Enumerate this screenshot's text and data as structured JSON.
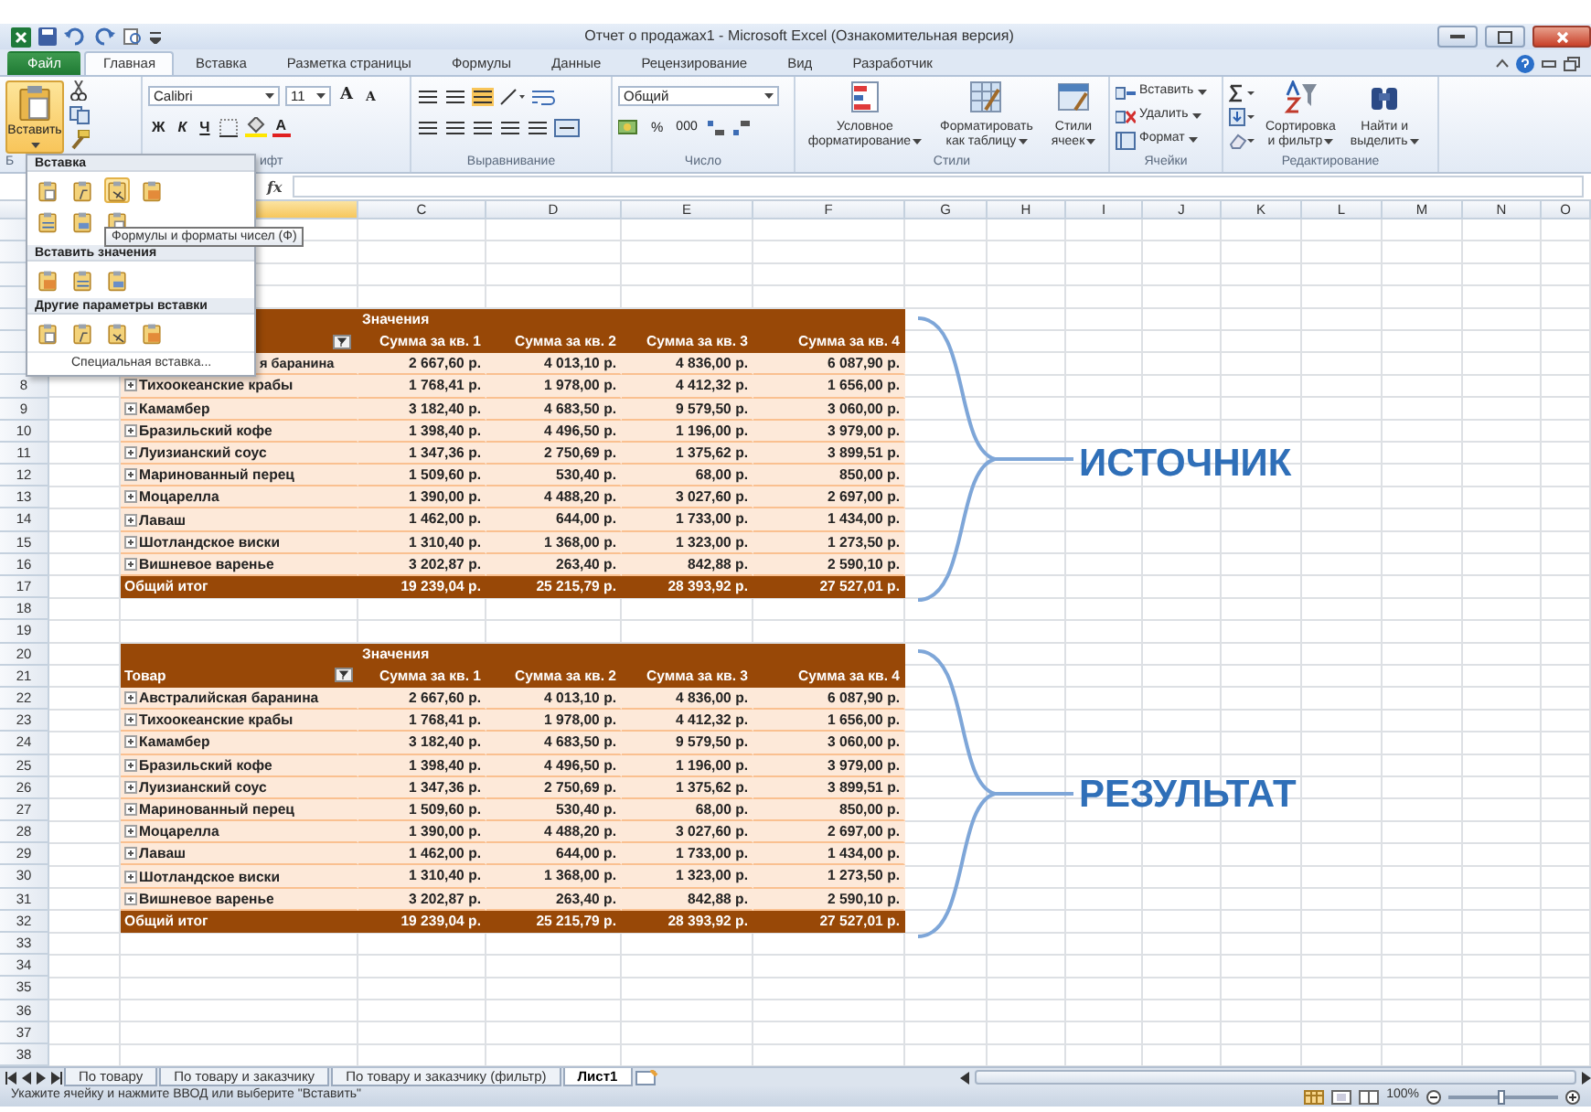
{
  "window": {
    "title": "Отчет о продажах1 - Microsoft Excel (Ознакомительная версия)"
  },
  "ribbon_tabs": [
    {
      "label": "Файл",
      "kind": "file",
      "selected": false
    },
    {
      "label": "Главная",
      "kind": "tab",
      "selected": true
    },
    {
      "label": "Вставка",
      "kind": "tab",
      "selected": false
    },
    {
      "label": "Разметка страницы",
      "kind": "tab",
      "selected": false
    },
    {
      "label": "Формулы",
      "kind": "tab",
      "selected": false
    },
    {
      "label": "Данные",
      "kind": "tab",
      "selected": false
    },
    {
      "label": "Рецензирование",
      "kind": "tab",
      "selected": false
    },
    {
      "label": "Вид",
      "kind": "tab",
      "selected": false
    },
    {
      "label": "Разработчик",
      "kind": "tab",
      "selected": false
    }
  ],
  "ribbon": {
    "paste_button": {
      "label": "Вставить",
      "open": true
    },
    "font_name": "Calibri",
    "font_size": "11",
    "grow_label": "A",
    "shrink_label": "A",
    "bold": "Ж",
    "italic": "К",
    "underline": "Ч",
    "font_color_label": "A",
    "number_format": "Общий",
    "percent": "%",
    "thousands": "000",
    "styles_buttons": [
      {
        "lines": [
          "Условное",
          "форматирование"
        ]
      },
      {
        "lines": [
          "Форматировать",
          "как таблицу"
        ]
      },
      {
        "lines": [
          "Стили",
          "ячеек"
        ]
      }
    ],
    "cells_buttons": [
      "Вставить",
      "Удалить",
      "Формат"
    ],
    "editing_buttons": [
      {
        "lines": [
          "Сортировка",
          "и фильтр"
        ]
      },
      {
        "lines": [
          "Найти и",
          "выделить"
        ]
      }
    ],
    "group_labels": [
      "Б",
      "ифт",
      "Выравнивание",
      "Число",
      "Стили",
      "Ячейки",
      "Редактирование"
    ]
  },
  "formula_bar": {
    "function_label": "fx"
  },
  "columns": [
    {
      "selected": true
    },
    {
      "letter": "C",
      "selected": false
    },
    {
      "letter": "D",
      "selected": false
    },
    {
      "letter": "E",
      "selected": false
    },
    {
      "letter": "F",
      "selected": false
    },
    {
      "letter": "G",
      "selected": false
    },
    {
      "letter": "H",
      "selected": false
    },
    {
      "letter": "I",
      "selected": false
    },
    {
      "letter": "J",
      "selected": false
    },
    {
      "letter": "K",
      "selected": false
    },
    {
      "letter": "L",
      "selected": false
    },
    {
      "letter": "M",
      "selected": false
    },
    {
      "letter": "N",
      "selected": false
    },
    {
      "letter": "O",
      "selected": false
    }
  ],
  "rows": [
    {
      "kind": "blank"
    },
    {
      "kind": "blank"
    },
    {
      "kind": "blank"
    },
    {
      "kind": "blank"
    },
    {
      "kind": "title",
      "title": "Значения"
    },
    {
      "kind": "header",
      "columns": [
        "Сумма за кв. 1",
        "Сумма за кв. 2",
        "Сумма за кв. 3",
        "Сумма за кв. 4"
      ]
    },
    {
      "kind": "item",
      "label": "я баранина",
      "clipped": true,
      "values": [
        "2 667,60 р.",
        "4 013,10 р.",
        "4 836,00 р.",
        "6 087,90 р."
      ]
    },
    {
      "number": "8",
      "kind": "item",
      "label": "Тихоокеанские крабы",
      "clipped": false,
      "values": [
        "1 768,41 р.",
        "1 978,00 р.",
        "4 412,32 р.",
        "1 656,00 р."
      ]
    },
    {
      "number": "9",
      "kind": "item",
      "label": "Камамбер",
      "clipped": false,
      "values": [
        "3 182,40 р.",
        "4 683,50 р.",
        "9 579,50 р.",
        "3 060,00 р."
      ]
    },
    {
      "number": "10",
      "kind": "item",
      "label": "Бразильский кофе",
      "clipped": false,
      "values": [
        "1 398,40 р.",
        "4 496,50 р.",
        "1 196,00 р.",
        "3 979,00 р."
      ]
    },
    {
      "number": "11",
      "kind": "item",
      "label": "Луизианский соус",
      "clipped": false,
      "values": [
        "1 347,36 р.",
        "2 750,69 р.",
        "1 375,62 р.",
        "3 899,51 р."
      ]
    },
    {
      "number": "12",
      "kind": "item",
      "label": "Маринованный перец",
      "clipped": false,
      "values": [
        "1 509,60 р.",
        "530,40 р.",
        "68,00 р.",
        "850,00 р."
      ]
    },
    {
      "number": "13",
      "kind": "item",
      "label": "Моцарелла",
      "clipped": false,
      "values": [
        "1 390,00 р.",
        "4 488,20 р.",
        "3 027,60 р.",
        "2 697,00 р."
      ]
    },
    {
      "number": "14",
      "kind": "item",
      "label": "Лаваш",
      "clipped": false,
      "values": [
        "1 462,00 р.",
        "644,00 р.",
        "1 733,00 р.",
        "1 434,00 р."
      ]
    },
    {
      "number": "15",
      "kind": "item",
      "label": "Шотландское виски",
      "clipped": false,
      "values": [
        "1 310,40 р.",
        "1 368,00 р.",
        "1 323,00 р.",
        "1 273,50 р."
      ]
    },
    {
      "number": "16",
      "kind": "item",
      "label": "Вишневое варенье",
      "clipped": false,
      "values": [
        "3 202,87 р.",
        "263,40 р.",
        "842,88 р.",
        "2 590,10 р."
      ]
    },
    {
      "number": "17",
      "kind": "total",
      "label": "Общий итог",
      "values": [
        "19 239,04 р.",
        "25 215,79 р.",
        "28 393,92 р.",
        "27 527,01 р."
      ]
    },
    {
      "number": "18",
      "kind": "blank"
    },
    {
      "number": "19",
      "kind": "blank"
    },
    {
      "number": "20",
      "kind": "title",
      "title": "Значения"
    },
    {
      "number": "21",
      "kind": "header",
      "label": "Товар",
      "columns": [
        "Сумма за кв. 1",
        "Сумма за кв. 2",
        "Сумма за кв. 3",
        "Сумма за кв. 4"
      ]
    },
    {
      "number": "22",
      "kind": "item",
      "label": "Австралийская баранина",
      "clipped": false,
      "values": [
        "2 667,60 р.",
        "4 013,10 р.",
        "4 836,00 р.",
        "6 087,90 р."
      ]
    },
    {
      "number": "23",
      "kind": "item",
      "label": "Тихоокеанские крабы",
      "clipped": false,
      "values": [
        "1 768,41 р.",
        "1 978,00 р.",
        "4 412,32 р.",
        "1 656,00 р."
      ]
    },
    {
      "number": "24",
      "kind": "item",
      "label": "Камамбер",
      "clipped": false,
      "values": [
        "3 182,40 р.",
        "4 683,50 р.",
        "9 579,50 р.",
        "3 060,00 р."
      ]
    },
    {
      "number": "25",
      "kind": "item",
      "label": "Бразильский кофе",
      "clipped": false,
      "values": [
        "1 398,40 р.",
        "4 496,50 р.",
        "1 196,00 р.",
        "3 979,00 р."
      ]
    },
    {
      "number": "26",
      "kind": "item",
      "label": "Луизианский соус",
      "clipped": false,
      "values": [
        "1 347,36 р.",
        "2 750,69 р.",
        "1 375,62 р.",
        "3 899,51 р."
      ]
    },
    {
      "number": "27",
      "kind": "item",
      "label": "Маринованный перец",
      "clipped": false,
      "values": [
        "1 509,60 р.",
        "530,40 р.",
        "68,00 р.",
        "850,00 р."
      ]
    },
    {
      "number": "28",
      "kind": "item",
      "label": "Моцарелла",
      "clipped": false,
      "values": [
        "1 390,00 р.",
        "4 488,20 р.",
        "3 027,60 р.",
        "2 697,00 р."
      ]
    },
    {
      "number": "29",
      "kind": "item",
      "label": "Лаваш",
      "clipped": false,
      "values": [
        "1 462,00 р.",
        "644,00 р.",
        "1 733,00 р.",
        "1 434,00 р."
      ]
    },
    {
      "number": "30",
      "kind": "item",
      "label": "Шотландское виски",
      "clipped": false,
      "values": [
        "1 310,40 р.",
        "1 368,00 р.",
        "1 323,00 р.",
        "1 273,50 р."
      ]
    },
    {
      "number": "31",
      "kind": "item",
      "label": "Вишневое варенье",
      "clipped": false,
      "values": [
        "3 202,87 р.",
        "263,40 р.",
        "842,88 р.",
        "2 590,10 р."
      ]
    },
    {
      "number": "32",
      "kind": "total",
      "label": "Общий итог",
      "values": [
        "19 239,04 р.",
        "25 215,79 р.",
        "28 393,92 р.",
        "27 527,01 р."
      ]
    },
    {
      "number": "33",
      "kind": "blank"
    },
    {
      "number": "34",
      "kind": "blank"
    },
    {
      "number": "35",
      "kind": "blank"
    },
    {
      "number": "36",
      "kind": "blank"
    },
    {
      "number": "37",
      "kind": "blank"
    },
    {
      "number": "38",
      "kind": "blank"
    }
  ],
  "annotations": [
    {
      "text": "ИСТОЧНИК"
    },
    {
      "text": "РЕЗУЛЬТАТ"
    }
  ],
  "paste_menu": {
    "sections": [
      {
        "title": "Вставка",
        "options": [
          {
            "highlighted": false
          },
          {
            "highlighted": false
          },
          {
            "highlighted": true
          },
          {
            "highlighted": false
          },
          {
            "highlighted": false
          },
          {
            "highlighted": false
          },
          {
            "highlighted": false
          }
        ]
      },
      {
        "title": "Вставить значения",
        "options": [
          {
            "highlighted": false
          },
          {
            "highlighted": false
          },
          {
            "highlighted": false
          }
        ]
      },
      {
        "title": "Другие параметры вставки",
        "options": [
          {
            "highlighted": false
          },
          {
            "highlighted": false
          },
          {
            "highlighted": false
          },
          {
            "highlighted": false
          }
        ]
      }
    ],
    "special": "Специальная вставка...",
    "tooltip": "Формулы и форматы чисел (Ф)"
  },
  "sheet_tabs": [
    {
      "label": "По товару",
      "selected": false
    },
    {
      "label": "По товару и заказчику",
      "selected": false
    },
    {
      "label": "По товару и заказчику (фильтр)",
      "selected": false
    },
    {
      "label": "Лист1",
      "selected": true
    }
  ],
  "status_bar": {
    "message": "Укажите ячейку и нажмите ВВОД или выберите \"Вставить\"",
    "zoom": "100%",
    "zoom_slider": {
      "level": 0.5
    }
  }
}
